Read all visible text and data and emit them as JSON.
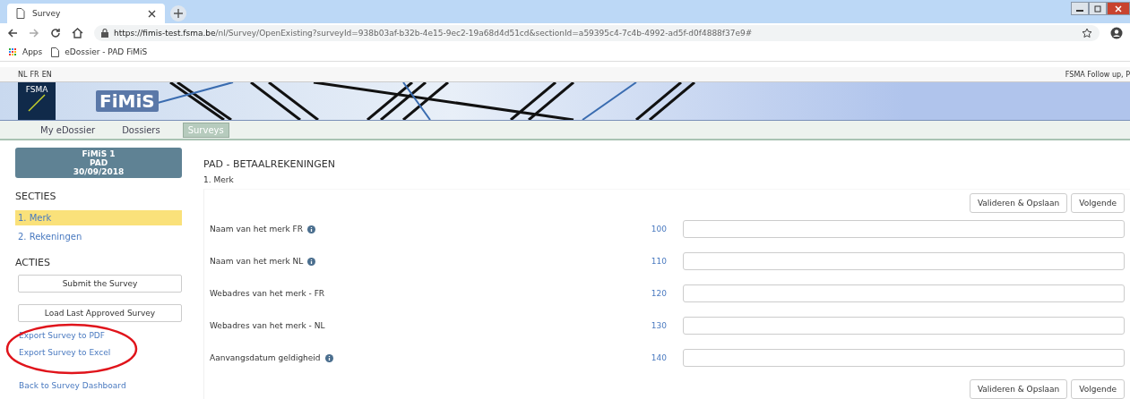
{
  "browser": {
    "tab_title": "Survey",
    "url_host": "https://fimis-test.fsma.be",
    "url_path": "/nl/Survey/OpenExisting?surveyId=938b03af-b32b-4e15-9ec2-19a68d4d51cd&sectionId=a59395c4-7c4b-4992-ad5f-d0f4888f37e9#",
    "bookmarks": [
      {
        "label": "Apps",
        "kind": "apps"
      },
      {
        "label": "eDossier - PAD FiMiS",
        "kind": "page"
      }
    ]
  },
  "languages": [
    "NL",
    "FR",
    "EN"
  ],
  "user": "FSMA Follow up, P",
  "logo": "FSMA",
  "app_name": "FiMiS",
  "nav": [
    {
      "label": "My eDossier",
      "selected": false
    },
    {
      "label": "Dossiers",
      "selected": false
    },
    {
      "label": "Surveys",
      "selected": true
    }
  ],
  "survey_card": [
    "FiMiS 1",
    "PAD",
    "30/09/2018"
  ],
  "sections_heading": "SECTIES",
  "sections": [
    {
      "label": "1. Merk",
      "selected": true
    },
    {
      "label": "2. Rekeningen",
      "selected": false
    }
  ],
  "actions_heading": "ACTIES",
  "actions": [
    {
      "label": "Submit the Survey",
      "kind": "button"
    },
    {
      "label": "Load Last Approved Survey",
      "kind": "button"
    },
    {
      "label": "Export Survey to PDF",
      "kind": "link"
    },
    {
      "label": "Export Survey to Excel",
      "kind": "link"
    }
  ],
  "back_link": "Back to Survey Dashboard",
  "main": {
    "title": "PAD - BETAALREKENINGEN",
    "section": "1. Merk",
    "buttons_top": [
      "Valideren & Opslaan",
      "Volgende"
    ],
    "buttons_bottom": [
      "Valideren & Opslaan",
      "Volgende"
    ],
    "fields": [
      {
        "label": "Naam van het merk FR",
        "info": true,
        "code": "100"
      },
      {
        "label": "Naam van het merk NL",
        "info": true,
        "code": "110"
      },
      {
        "label": "Webadres van het merk - FR",
        "info": false,
        "code": "120"
      },
      {
        "label": "Webadres van het merk - NL",
        "info": false,
        "code": "130"
      },
      {
        "label": "Aanvangsdatum geldigheid",
        "info": true,
        "code": "140"
      }
    ]
  }
}
